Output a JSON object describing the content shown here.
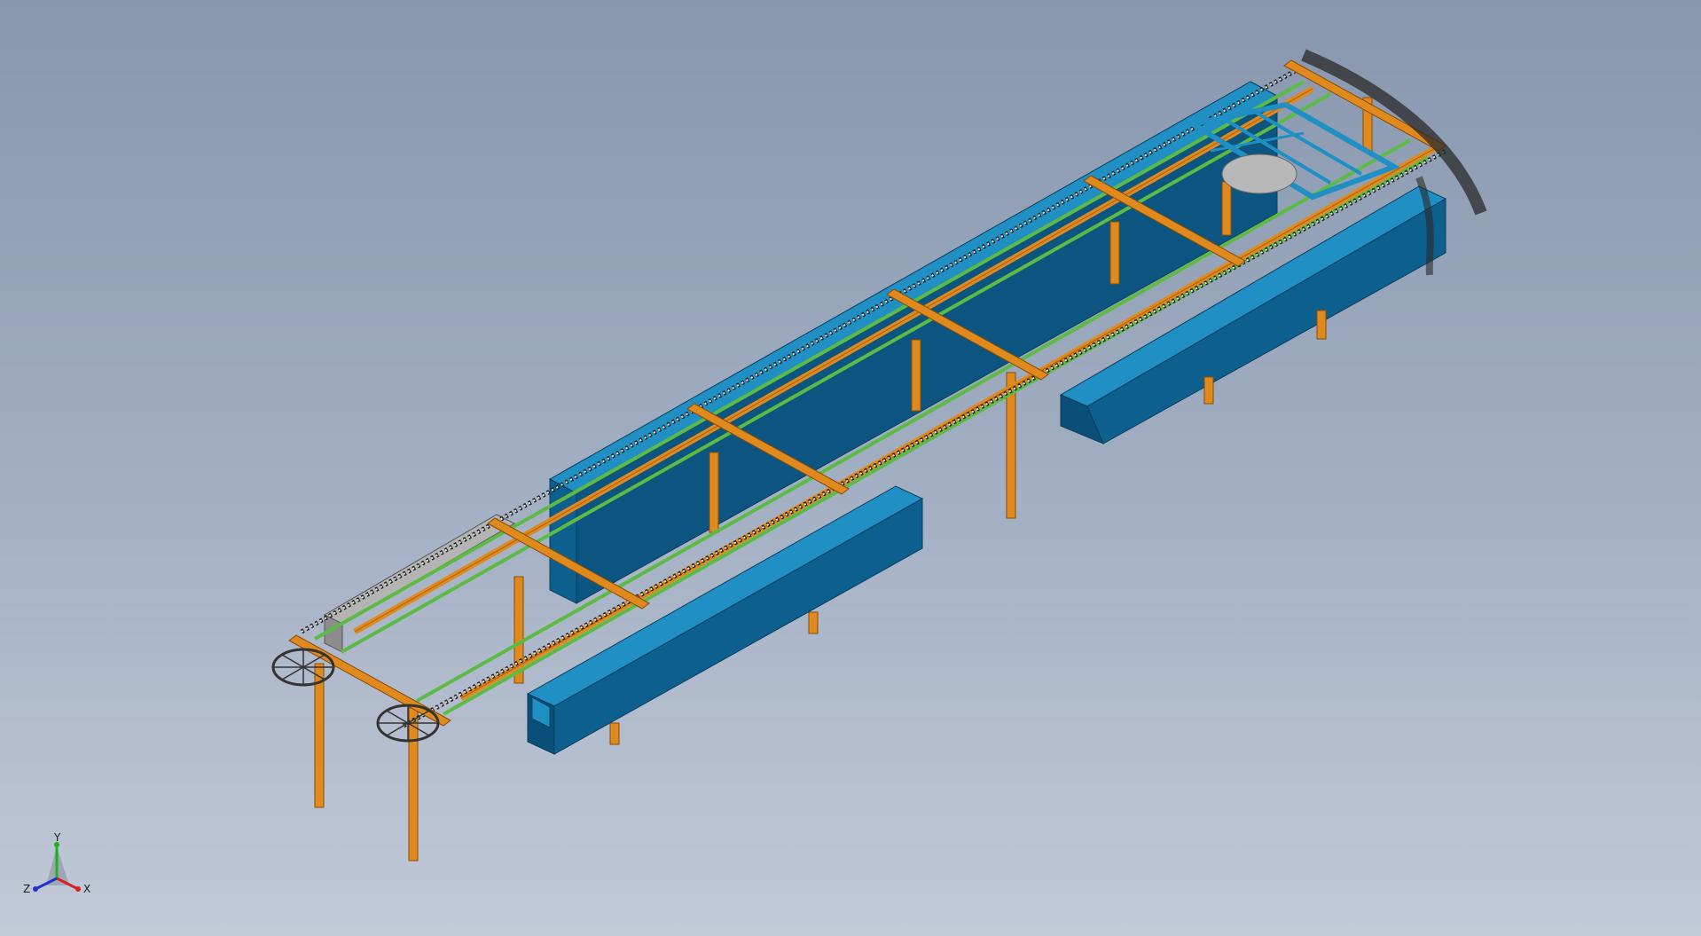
{
  "viewport": {
    "background_top": "#8797ad",
    "background_bottom": "#c2cad8"
  },
  "model": {
    "colors": {
      "frame": "#e08a1e",
      "frame_dark": "#a85f0c",
      "trough_top": "#1f8fc4",
      "trough_side": "#0d5f8e",
      "trough_inner": "#0a4f78",
      "rail": "#5dbb45",
      "chain": "#3a3a3a",
      "grey_part": "#9c9c9c"
    }
  },
  "triad": {
    "x_label": "X",
    "y_label": "Y",
    "z_label": "Z",
    "x_color": "#d42020",
    "y_color": "#20b020",
    "z_color": "#2030d0"
  }
}
